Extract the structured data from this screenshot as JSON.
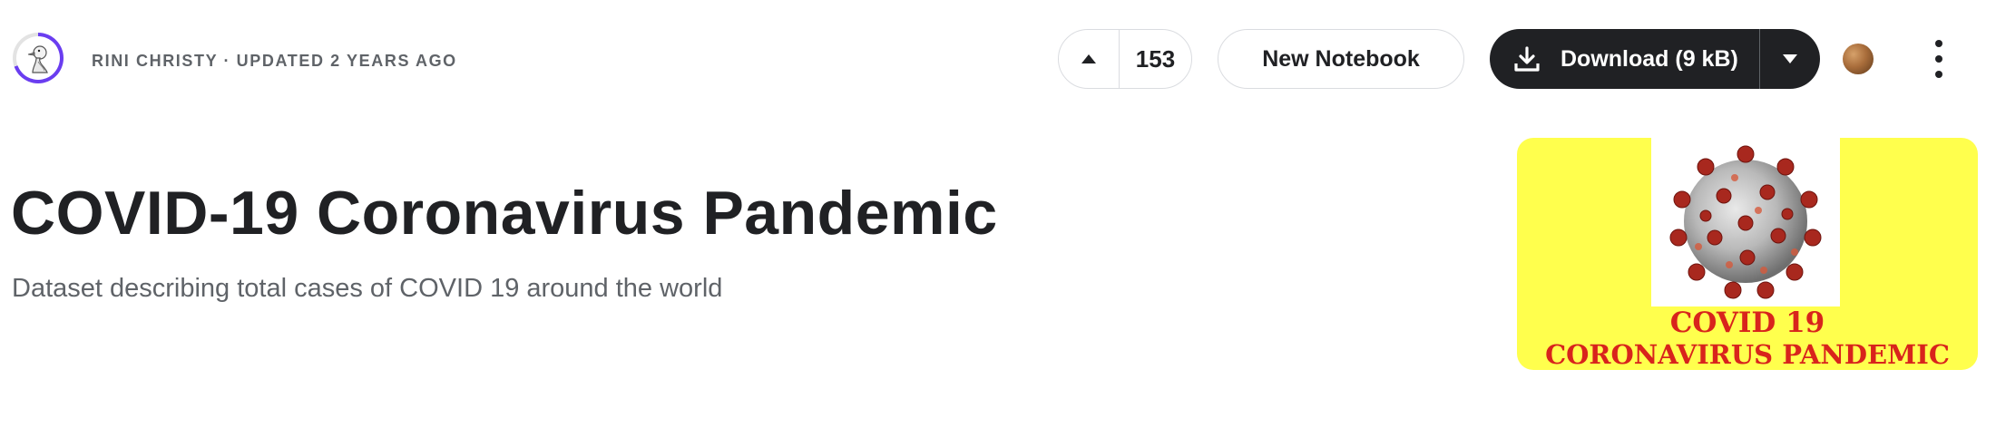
{
  "author": {
    "meta_text": "RINI CHRISTY · UPDATED 2 YEARS AGO"
  },
  "actions": {
    "upvote_count": "153",
    "new_notebook_label": "New Notebook",
    "download_label": "Download (9 kB)"
  },
  "dataset": {
    "title": "COVID-19 Coronavirus Pandemic",
    "subtitle": "Dataset describing total cases of COVID 19 around the world"
  },
  "cover_image": {
    "line1": "COVID 19",
    "line2": "CORONAVIRUS PANDEMIC",
    "background_color": "#ffff4d",
    "text_color": "#d8241c"
  },
  "icons": {
    "avatar": "duck-avatar-icon",
    "upvote": "caret-up-icon",
    "download": "download-icon",
    "download_menu": "caret-down-icon",
    "profile": "profile-avatar-icon",
    "more": "more-vertical-icon"
  },
  "colors": {
    "primary_button": "#202124",
    "avatar_ring": "#6a3df0"
  }
}
